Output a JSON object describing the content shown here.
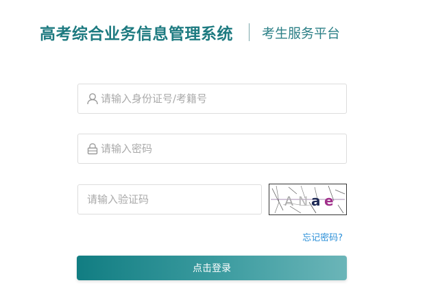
{
  "header": {
    "system_title": "高考综合业务信息管理系统",
    "platform_name": "考生服务平台"
  },
  "form": {
    "id_placeholder": "请输入身份证号/考籍号",
    "id_value": "",
    "password_placeholder": "请输入密码",
    "password_value": "",
    "captcha_placeholder": "请输入验证码",
    "captcha_value": "",
    "captcha_text": "ANae",
    "forgot_password": "忘记密码?",
    "login_button": "点击登录"
  },
  "icons": {
    "id_field": "user-icon",
    "password_field": "lock-icon"
  },
  "colors": {
    "brand_title": "#1d7a80",
    "platform_text": "#2b7f86",
    "link": "#2a8fd8",
    "button_start": "#117d82",
    "button_end": "#6bb5b8",
    "placeholder": "#a9a9a9",
    "border": "#dcdcdc"
  }
}
